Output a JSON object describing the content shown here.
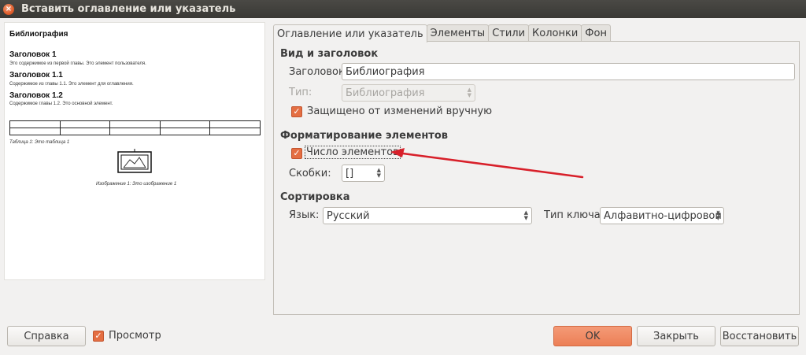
{
  "window": {
    "title": "Вставить оглавление или указатель",
    "close_glyph": "×"
  },
  "preview": {
    "title": "Библиография",
    "h1": "Заголовок 1",
    "t1": "Это содержимое из первой главы. Это элемент пользователя.",
    "h11": "Заголовок 1.1",
    "t11": "Содержимое из главы 1.1. Это элемент для оглавления.",
    "h12": "Заголовок 1.2",
    "t12": "Содержимое главы 1.2. Это основной элемент.",
    "table_caption": "Таблица 1: Это таблица 1",
    "image_caption": "Изображение 1: Это изображение 1"
  },
  "tabs": [
    {
      "label": "Оглавление или указатель",
      "active": true
    },
    {
      "label": "Элементы",
      "active": false
    },
    {
      "label": "Стили",
      "active": false
    },
    {
      "label": "Колонки",
      "active": false
    },
    {
      "label": "Фон",
      "active": false
    }
  ],
  "type_title": {
    "section": "Вид и заголовок",
    "title_label": "Заголовок:",
    "title_value": "Библиография",
    "type_label": "Тип:",
    "type_value": "Библиография",
    "protected_label": "Защищено от изменений вручную",
    "protected_checked": true
  },
  "entries": {
    "section": "Форматирование элементов",
    "number_label": "Число элементов",
    "number_checked": true,
    "brackets_label": "Скобки:",
    "brackets_value": "[]"
  },
  "sort": {
    "section": "Сортировка",
    "language_label": "Язык:",
    "language_value": "Русский",
    "key_label": "Тип ключа:",
    "key_value": "Алфавитно-цифровой"
  },
  "footer": {
    "help": "Справка",
    "preview_label": "Просмотр",
    "preview_checked": true,
    "ok": "OK",
    "close": "Закрыть",
    "reset": "Восстановить"
  },
  "colors": {
    "accent": "#e46e42",
    "arrow": "#d8202a",
    "titlebar": "#3c3b37"
  },
  "icons": {
    "check": "✓",
    "spin_up": "▲",
    "spin_down": "▼"
  }
}
